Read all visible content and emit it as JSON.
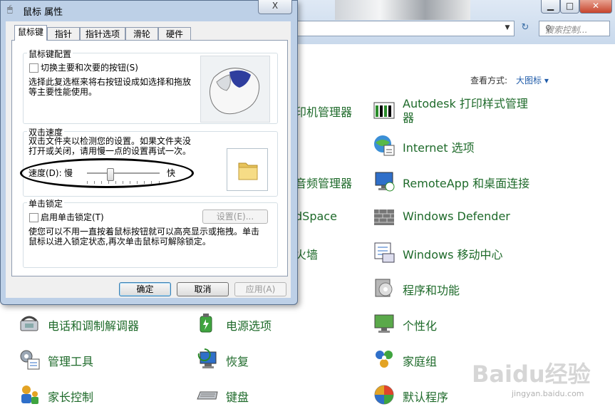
{
  "control_panel": {
    "search_placeholder": "搜索控制...",
    "view_by_label": "查看方式:",
    "view_by_value": "大图标 ▾",
    "items": [
      {
        "label": "印机管理器",
        "icon": "printer-icon"
      },
      {
        "label": "Autodesk 打印样式管理器",
        "icon": "autodesk-plot-style-icon"
      },
      {
        "label": "Internet 选项",
        "icon": "internet-options-icon"
      },
      {
        "label": "音频管理器",
        "icon": "audio-manager-icon"
      },
      {
        "label": "RemoteApp 和桌面连接",
        "icon": "remoteapp-icon"
      },
      {
        "label": "dSpace",
        "icon": "dspace-icon"
      },
      {
        "label": "Windows Defender",
        "icon": "windows-defender-icon"
      },
      {
        "label": "火墙",
        "icon": "firewall-icon"
      },
      {
        "label": "Windows 移动中心",
        "icon": "mobility-center-icon"
      },
      {
        "label": "程序和功能",
        "icon": "programs-features-icon"
      },
      {
        "label": "电话和调制解调器",
        "icon": "phone-modem-icon"
      },
      {
        "label": "电源选项",
        "icon": "power-options-icon"
      },
      {
        "label": "个性化",
        "icon": "personalization-icon"
      },
      {
        "label": "管理工具",
        "icon": "admin-tools-icon"
      },
      {
        "label": "恢复",
        "icon": "recovery-icon"
      },
      {
        "label": "家庭组",
        "icon": "homegroup-icon"
      },
      {
        "label": "家长控制",
        "icon": "parental-controls-icon"
      },
      {
        "label": "键盘",
        "icon": "keyboard-icon"
      },
      {
        "label": "默认程序",
        "icon": "default-programs-icon"
      }
    ]
  },
  "dialog": {
    "title": "鼠标 属性",
    "close_label": "X",
    "tabs": [
      "鼠标键",
      "指针",
      "指针选项",
      "滑轮",
      "硬件"
    ],
    "active_tab": 0,
    "button_config": {
      "group_label": "鼠标键配置",
      "checkbox_label": "切换主要和次要的按钮(S)",
      "checked": false,
      "description": "选择此复选框来将右按钮设成如选择和拖放等主要性能使用。"
    },
    "double_click": {
      "group_label": "双击速度",
      "description": "双击文件夹以检测您的设置。如果文件夹没打开或关闭，请用慢一点的设置再试一次。",
      "speed_label": "速度(D):",
      "slow_label": "慢",
      "fast_label": "快",
      "speed_level": 0.3
    },
    "click_lock": {
      "group_label": "单击锁定",
      "checkbox_label": "启用单击锁定(T)",
      "checked": false,
      "settings_button": "设置(E)...",
      "description": "使您可以不用一直按着鼠标按钮就可以高亮显示或拖拽。单击鼠标以进入锁定状态,再次单击鼠标可解除锁定。"
    },
    "buttons": {
      "ok": "确定",
      "cancel": "取消",
      "apply": "应用(A)"
    }
  },
  "watermark": {
    "logo": "Baidu经验",
    "url": "jingyan.baidu.com"
  }
}
